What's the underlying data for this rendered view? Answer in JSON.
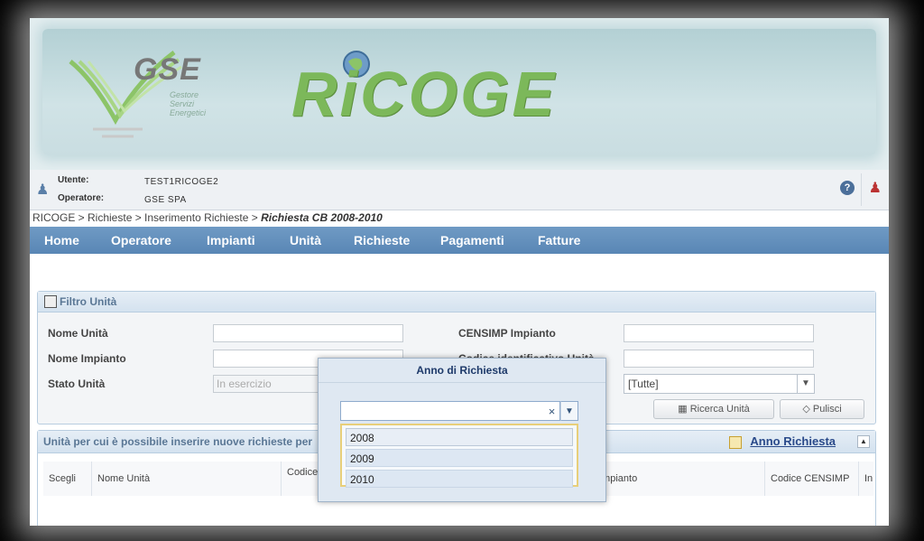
{
  "header": {
    "logo_text": "GSE",
    "logo_subtitle": [
      "Gestore",
      "Servizi",
      "Energetici"
    ],
    "app_title": "RiCOGE"
  },
  "userbar": {
    "user_label": "Utente:",
    "user_value": "TEST1RICOGE2",
    "operator_label": "Operatore:",
    "operator_value": "GSE SPA"
  },
  "breadcrumb": {
    "path": "RICOGE > Richieste > Inserimento Richieste > ",
    "current": "Richiesta CB 2008-2010"
  },
  "nav": {
    "items": [
      "Home",
      "Operatore",
      "Impianti",
      "Unità",
      "Richieste",
      "Pagamenti",
      "Fatture"
    ]
  },
  "filter": {
    "title": "Filtro Unità",
    "nome_unita_label": "Nome Unità",
    "nome_impianto_label": "Nome Impianto",
    "stato_unita_label": "Stato Unità",
    "stato_unita_value": "In esercizio",
    "censimp_label": "CENSIMP Impianto",
    "codice_label": "Codice identificativo Unità",
    "select_value": "[Tutte]",
    "search_button": "Ricerca Unità",
    "clear_button": "Pulisci"
  },
  "results": {
    "title": "Unità per cui è possibile inserire nuove richieste per",
    "anno_link": "Anno Richiesta",
    "columns": [
      "Scegli",
      "Nome Unità",
      "Codice",
      "Impianto",
      "Codice CENSIMP",
      "In"
    ]
  },
  "dialog": {
    "title": "Anno di Richiesta",
    "input_value": "",
    "options": [
      "2008",
      "2009",
      "2010"
    ]
  }
}
